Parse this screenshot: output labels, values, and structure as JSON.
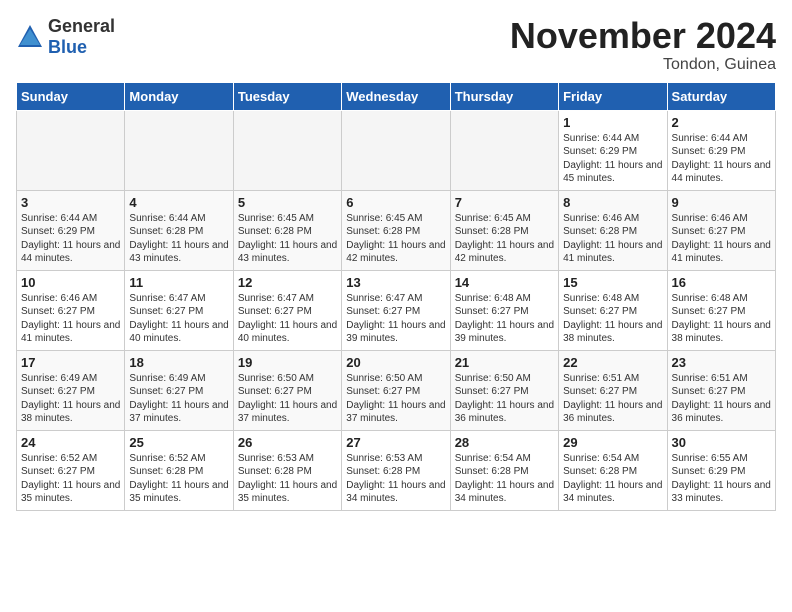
{
  "logo": {
    "general": "General",
    "blue": "Blue"
  },
  "header": {
    "month": "November 2024",
    "location": "Tondon, Guinea"
  },
  "weekdays": [
    "Sunday",
    "Monday",
    "Tuesday",
    "Wednesday",
    "Thursday",
    "Friday",
    "Saturday"
  ],
  "weeks": [
    [
      {
        "day": "",
        "empty": true
      },
      {
        "day": "",
        "empty": true
      },
      {
        "day": "",
        "empty": true
      },
      {
        "day": "",
        "empty": true
      },
      {
        "day": "",
        "empty": true
      },
      {
        "day": "1",
        "sunrise": "Sunrise: 6:44 AM",
        "sunset": "Sunset: 6:29 PM",
        "daylight": "Daylight: 11 hours and 45 minutes."
      },
      {
        "day": "2",
        "sunrise": "Sunrise: 6:44 AM",
        "sunset": "Sunset: 6:29 PM",
        "daylight": "Daylight: 11 hours and 44 minutes."
      }
    ],
    [
      {
        "day": "3",
        "sunrise": "Sunrise: 6:44 AM",
        "sunset": "Sunset: 6:29 PM",
        "daylight": "Daylight: 11 hours and 44 minutes."
      },
      {
        "day": "4",
        "sunrise": "Sunrise: 6:44 AM",
        "sunset": "Sunset: 6:28 PM",
        "daylight": "Daylight: 11 hours and 43 minutes."
      },
      {
        "day": "5",
        "sunrise": "Sunrise: 6:45 AM",
        "sunset": "Sunset: 6:28 PM",
        "daylight": "Daylight: 11 hours and 43 minutes."
      },
      {
        "day": "6",
        "sunrise": "Sunrise: 6:45 AM",
        "sunset": "Sunset: 6:28 PM",
        "daylight": "Daylight: 11 hours and 42 minutes."
      },
      {
        "day": "7",
        "sunrise": "Sunrise: 6:45 AM",
        "sunset": "Sunset: 6:28 PM",
        "daylight": "Daylight: 11 hours and 42 minutes."
      },
      {
        "day": "8",
        "sunrise": "Sunrise: 6:46 AM",
        "sunset": "Sunset: 6:28 PM",
        "daylight": "Daylight: 11 hours and 41 minutes."
      },
      {
        "day": "9",
        "sunrise": "Sunrise: 6:46 AM",
        "sunset": "Sunset: 6:27 PM",
        "daylight": "Daylight: 11 hours and 41 minutes."
      }
    ],
    [
      {
        "day": "10",
        "sunrise": "Sunrise: 6:46 AM",
        "sunset": "Sunset: 6:27 PM",
        "daylight": "Daylight: 11 hours and 41 minutes."
      },
      {
        "day": "11",
        "sunrise": "Sunrise: 6:47 AM",
        "sunset": "Sunset: 6:27 PM",
        "daylight": "Daylight: 11 hours and 40 minutes."
      },
      {
        "day": "12",
        "sunrise": "Sunrise: 6:47 AM",
        "sunset": "Sunset: 6:27 PM",
        "daylight": "Daylight: 11 hours and 40 minutes."
      },
      {
        "day": "13",
        "sunrise": "Sunrise: 6:47 AM",
        "sunset": "Sunset: 6:27 PM",
        "daylight": "Daylight: 11 hours and 39 minutes."
      },
      {
        "day": "14",
        "sunrise": "Sunrise: 6:48 AM",
        "sunset": "Sunset: 6:27 PM",
        "daylight": "Daylight: 11 hours and 39 minutes."
      },
      {
        "day": "15",
        "sunrise": "Sunrise: 6:48 AM",
        "sunset": "Sunset: 6:27 PM",
        "daylight": "Daylight: 11 hours and 38 minutes."
      },
      {
        "day": "16",
        "sunrise": "Sunrise: 6:48 AM",
        "sunset": "Sunset: 6:27 PM",
        "daylight": "Daylight: 11 hours and 38 minutes."
      }
    ],
    [
      {
        "day": "17",
        "sunrise": "Sunrise: 6:49 AM",
        "sunset": "Sunset: 6:27 PM",
        "daylight": "Daylight: 11 hours and 38 minutes."
      },
      {
        "day": "18",
        "sunrise": "Sunrise: 6:49 AM",
        "sunset": "Sunset: 6:27 PM",
        "daylight": "Daylight: 11 hours and 37 minutes."
      },
      {
        "day": "19",
        "sunrise": "Sunrise: 6:50 AM",
        "sunset": "Sunset: 6:27 PM",
        "daylight": "Daylight: 11 hours and 37 minutes."
      },
      {
        "day": "20",
        "sunrise": "Sunrise: 6:50 AM",
        "sunset": "Sunset: 6:27 PM",
        "daylight": "Daylight: 11 hours and 37 minutes."
      },
      {
        "day": "21",
        "sunrise": "Sunrise: 6:50 AM",
        "sunset": "Sunset: 6:27 PM",
        "daylight": "Daylight: 11 hours and 36 minutes."
      },
      {
        "day": "22",
        "sunrise": "Sunrise: 6:51 AM",
        "sunset": "Sunset: 6:27 PM",
        "daylight": "Daylight: 11 hours and 36 minutes."
      },
      {
        "day": "23",
        "sunrise": "Sunrise: 6:51 AM",
        "sunset": "Sunset: 6:27 PM",
        "daylight": "Daylight: 11 hours and 36 minutes."
      }
    ],
    [
      {
        "day": "24",
        "sunrise": "Sunrise: 6:52 AM",
        "sunset": "Sunset: 6:27 PM",
        "daylight": "Daylight: 11 hours and 35 minutes."
      },
      {
        "day": "25",
        "sunrise": "Sunrise: 6:52 AM",
        "sunset": "Sunset: 6:28 PM",
        "daylight": "Daylight: 11 hours and 35 minutes."
      },
      {
        "day": "26",
        "sunrise": "Sunrise: 6:53 AM",
        "sunset": "Sunset: 6:28 PM",
        "daylight": "Daylight: 11 hours and 35 minutes."
      },
      {
        "day": "27",
        "sunrise": "Sunrise: 6:53 AM",
        "sunset": "Sunset: 6:28 PM",
        "daylight": "Daylight: 11 hours and 34 minutes."
      },
      {
        "day": "28",
        "sunrise": "Sunrise: 6:54 AM",
        "sunset": "Sunset: 6:28 PM",
        "daylight": "Daylight: 11 hours and 34 minutes."
      },
      {
        "day": "29",
        "sunrise": "Sunrise: 6:54 AM",
        "sunset": "Sunset: 6:28 PM",
        "daylight": "Daylight: 11 hours and 34 minutes."
      },
      {
        "day": "30",
        "sunrise": "Sunrise: 6:55 AM",
        "sunset": "Sunset: 6:29 PM",
        "daylight": "Daylight: 11 hours and 33 minutes."
      }
    ]
  ]
}
